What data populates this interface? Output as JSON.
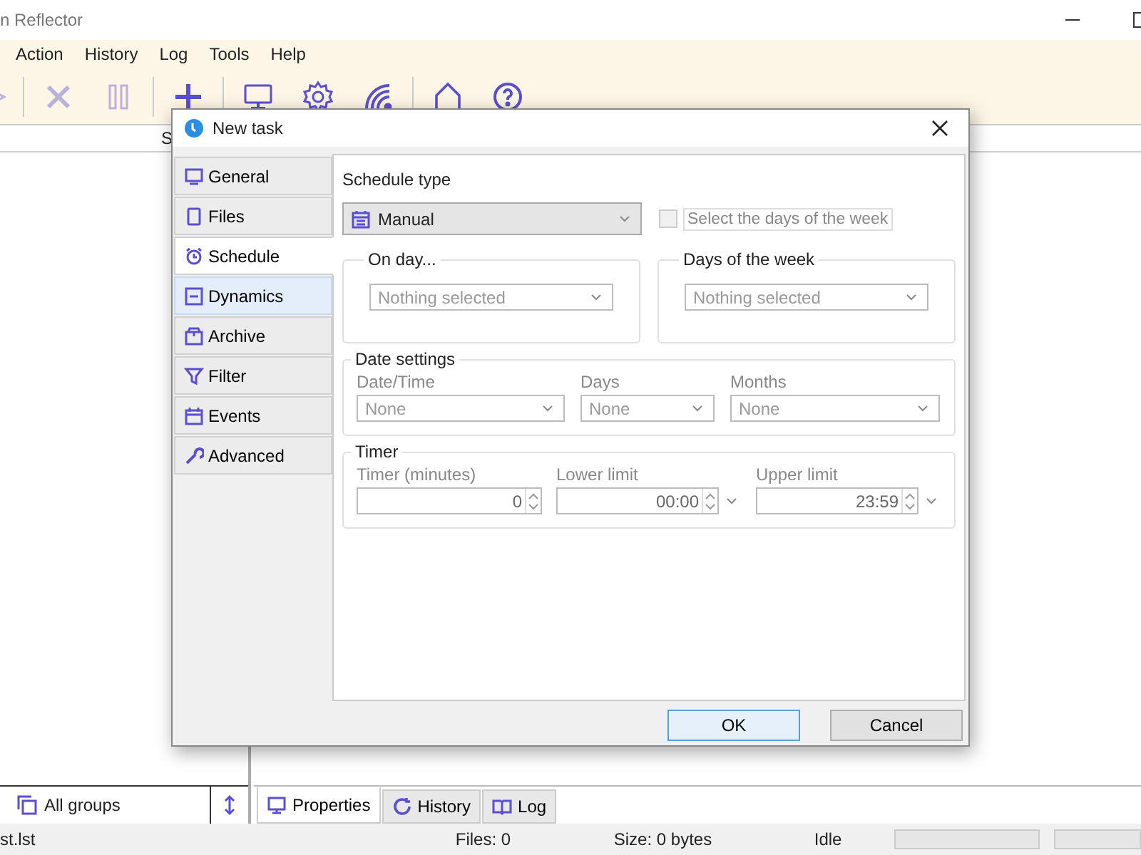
{
  "window": {
    "title": "n Reflector"
  },
  "menu": [
    "Action",
    "History",
    "Log",
    "Tools",
    "Help"
  ],
  "toolbar": [
    {
      "kind": "button",
      "disabled": true
    },
    {
      "kind": "separator"
    },
    {
      "kind": "button",
      "disabled": true
    },
    {
      "kind": "button",
      "disabled": true
    },
    {
      "kind": "separator"
    },
    {
      "kind": "button",
      "disabled": false
    },
    {
      "kind": "separator"
    },
    {
      "kind": "button",
      "disabled": false
    },
    {
      "kind": "button",
      "disabled": false
    },
    {
      "kind": "button",
      "disabled": false
    },
    {
      "kind": "separator"
    },
    {
      "kind": "button",
      "disabled": false
    },
    {
      "kind": "button",
      "disabled": false
    }
  ],
  "list_header": {
    "column_1": "S"
  },
  "groups_field": {
    "value": "All groups"
  },
  "bottom_tabs": [
    {
      "label": "Properties",
      "selected": true
    },
    {
      "label": "History",
      "selected": false
    },
    {
      "label": "Log",
      "selected": false
    }
  ],
  "status_bar": {
    "file": "st.lst",
    "files": "Files: 0",
    "size": "Size: 0 bytes",
    "state": "Idle",
    "progress": [
      {
        "level": 0
      },
      {
        "level": 0
      }
    ]
  },
  "dialog": {
    "title": "New task",
    "tabs": [
      {
        "label": "General",
        "selected": false,
        "hovered": false
      },
      {
        "label": "Files",
        "selected": false,
        "hovered": false
      },
      {
        "label": "Schedule",
        "selected": true,
        "hovered": false
      },
      {
        "label": "Dynamics",
        "selected": false,
        "hovered": true
      },
      {
        "label": "Archive",
        "selected": false,
        "hovered": false
      },
      {
        "label": "Filter",
        "selected": false,
        "hovered": false
      },
      {
        "label": "Events",
        "selected": false,
        "hovered": false
      },
      {
        "label": "Advanced",
        "selected": false,
        "hovered": false
      }
    ],
    "schedule_type": {
      "label": "Schedule type",
      "value": "Manual"
    },
    "days_checkbox": {
      "label": "Select the days of the week",
      "checked": false,
      "disabled": true
    },
    "on_day": {
      "title": "On day...",
      "dropdown": {
        "value": "Nothing selected",
        "disabled": true
      }
    },
    "days_of_week": {
      "title": "Days of the week",
      "dropdown": {
        "value": "Nothing selected",
        "disabled": true
      }
    },
    "date_settings": {
      "title": "Date settings",
      "fields": [
        {
          "label": "Date/Time",
          "value": "None",
          "disabled": true
        },
        {
          "label": "Days",
          "value": "None",
          "disabled": true
        },
        {
          "label": "Months",
          "value": "None",
          "disabled": true
        }
      ]
    },
    "timer": {
      "title": "Timer",
      "fields": [
        {
          "kind": "spin",
          "label": "Timer (minutes)",
          "value": "0",
          "disabled": true
        },
        {
          "kind": "spin_dropdown",
          "label": "Lower limit",
          "value": "00:00",
          "disabled": true
        },
        {
          "kind": "spin_dropdown",
          "label": "Upper limit",
          "value": "23:59",
          "disabled": true
        }
      ]
    },
    "buttons": [
      {
        "label": "OK",
        "default": true
      },
      {
        "label": "Cancel",
        "default": false
      }
    ]
  }
}
